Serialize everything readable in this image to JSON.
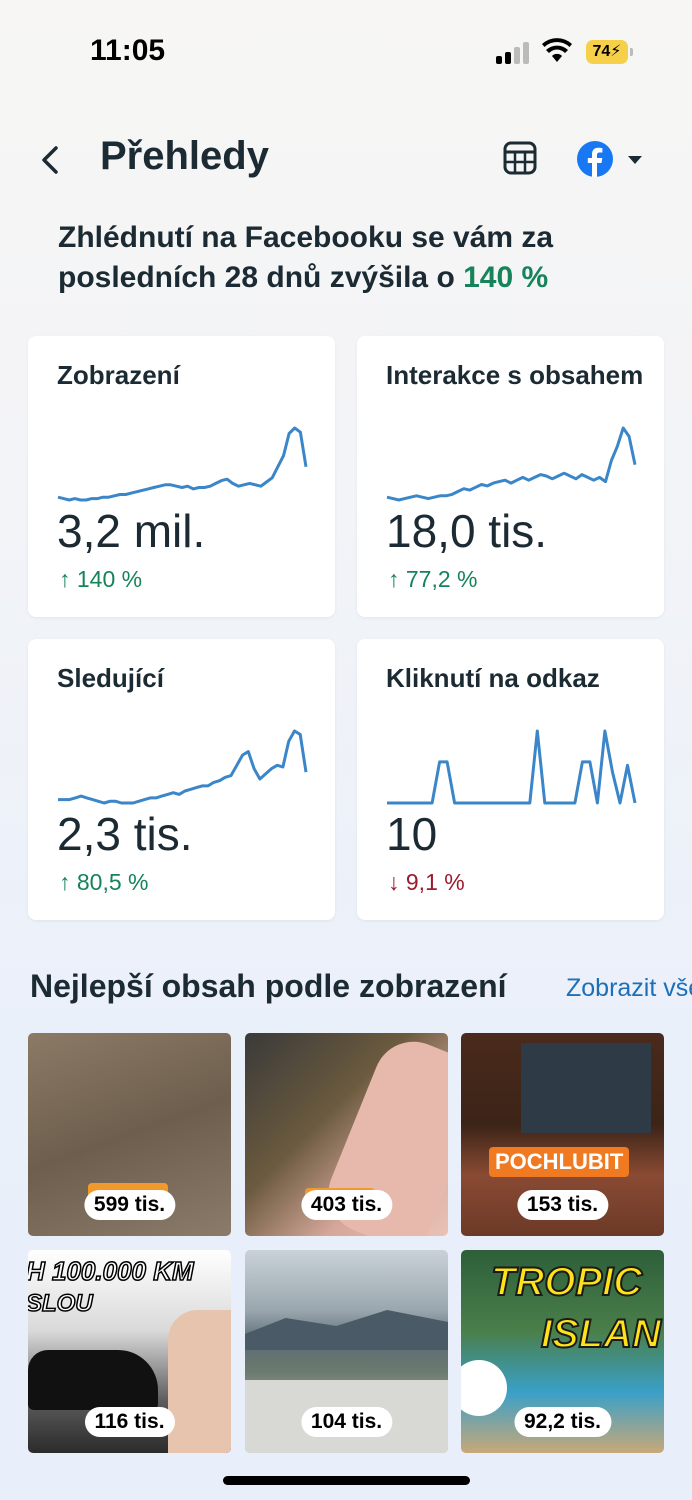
{
  "status_bar": {
    "time": "11:05",
    "battery": "74"
  },
  "header": {
    "title": "Přehledy",
    "back_icon": "chevron-left-icon",
    "table_icon": "table-icon",
    "account_icon": "facebook-icon"
  },
  "headline": {
    "text": "Zhlédnutí na Facebooku se vám za posledních 28 dnů zvýšila o ",
    "percent": "140 %"
  },
  "metrics": [
    {
      "title": "Zobrazení",
      "value": "3,2 mil.",
      "change": "↑ 140 %",
      "trend": "up",
      "spark": [
        12,
        13,
        14,
        13,
        14,
        14,
        13,
        13,
        12,
        12,
        11,
        10,
        10,
        9,
        8,
        7,
        6,
        5,
        4,
        3,
        3,
        4,
        5,
        4,
        6,
        5,
        5,
        4,
        2,
        0,
        -1,
        2,
        4,
        3,
        2,
        3,
        4,
        1,
        -2,
        -10,
        -18,
        -34,
        -38,
        -35,
        -10
      ]
    },
    {
      "title": "Interakce s obsahem",
      "value": "18,0 tis.",
      "change": "↑ 77,2 %",
      "trend": "up",
      "spark": [
        11,
        12,
        13,
        12,
        11,
        10,
        11,
        12,
        11,
        10,
        10,
        9,
        7,
        5,
        6,
        4,
        2,
        3,
        1,
        0,
        -1,
        1,
        -1,
        -3,
        -1,
        -3,
        -5,
        -4,
        -2,
        -4,
        -6,
        -4,
        -2,
        -5,
        -3,
        -1,
        -3,
        0,
        -15,
        -25,
        -38,
        -32,
        -12
      ]
    },
    {
      "title": "Sledující",
      "value": "2,3 tis.",
      "change": "↑ 80,5 %",
      "trend": "up",
      "spark": [
        10,
        10,
        10,
        9,
        8,
        9,
        10,
        11,
        12,
        11,
        11,
        12,
        12,
        12,
        11,
        10,
        9,
        9,
        8,
        7,
        6,
        7,
        5,
        4,
        3,
        2,
        2,
        0,
        -1,
        -3,
        -4,
        -10,
        -16,
        -18,
        -8,
        -2,
        -5,
        -8,
        -10,
        -9,
        -24,
        -30,
        -28,
        -6
      ]
    },
    {
      "title": "Kliknutí na odkaz",
      "value": "10",
      "change": "↓ 9,1 %",
      "trend": "down",
      "spark": [
        0,
        0,
        0,
        0,
        0,
        0,
        0,
        -24,
        -24,
        0,
        0,
        0,
        0,
        0,
        0,
        0,
        0,
        0,
        0,
        0,
        -42,
        0,
        0,
        0,
        0,
        0,
        -24,
        -24,
        0,
        -42,
        -18,
        0,
        -22,
        0
      ]
    }
  ],
  "top_content": {
    "title": "Nejlepší obsah podle zobrazení",
    "see_all": "Zobrazit vše",
    "items": [
      {
        "views": "599 tis."
      },
      {
        "views": "403 tis."
      },
      {
        "views": "153 tis.",
        "overlay": "POCHLUBIT"
      },
      {
        "views": "116 tis.",
        "overlay": "H 100.000 KM",
        "overlay2": "SLOU"
      },
      {
        "views": "104 tis."
      },
      {
        "views": "92,2 tis.",
        "overlay": "TROPIC",
        "overlay2": "ISLAN"
      }
    ]
  },
  "colors": {
    "positive": "#16835a",
    "negative": "#9b1c2e",
    "sparkline": "#3a86c8",
    "link": "#1d6fb8",
    "facebook": "#1877f2"
  }
}
